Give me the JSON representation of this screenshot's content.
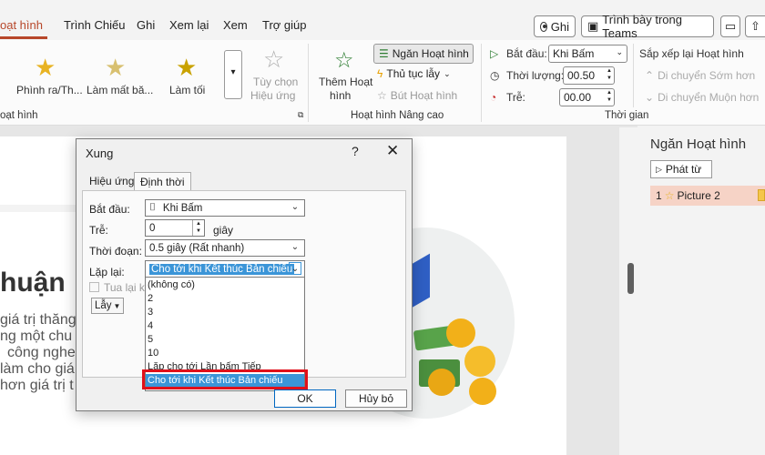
{
  "menu": {
    "tabs": [
      "oạt hình",
      "Trình Chiếu",
      "Ghi",
      "Xem lại",
      "Xem",
      "Trợ giúp"
    ],
    "record_button": "Ghi",
    "teams_button": "Trình bày trong Teams"
  },
  "ribbon": {
    "effects": [
      "Phình ra/Th...",
      "Làm mất bă...",
      "Làm tối"
    ],
    "effect_options": [
      "Tùy chọn",
      "Hiệu ứng"
    ],
    "group_animation": "oạt hình",
    "add_animation": [
      "Thêm Hoạt",
      "hình"
    ],
    "animation_pane": "Ngăn Hoạt hình",
    "trigger": "Thủ tục lẫy",
    "painter": "Bút Hoạt hình",
    "group_advanced": "Hoạt hình Nâng cao",
    "start_label": "Bắt đầu:",
    "start_value": "Khi Bấm",
    "duration_label": "Thời lượng:",
    "duration_value": "00.50",
    "delay_label": "Trễ:",
    "delay_value": "00.00",
    "reorder_title": "Sắp xếp lại Hoạt hình",
    "move_earlier": "Di chuyển Sớm hơn",
    "move_later": "Di chuyển Muộn hơn",
    "group_timing": "Thời gian"
  },
  "slide": {
    "heading": "huận",
    "lines": [
      "giá trị thăng",
      "ng một chu",
      "công nghe",
      "làm cho giá",
      "hơn giá trị t"
    ]
  },
  "pane": {
    "title": "Ngăn Hoạt hình",
    "play_from": "Phát từ",
    "item_index": "1",
    "item_label": "Picture 2"
  },
  "dialog": {
    "title": "Xung",
    "help": "?",
    "close": "✕",
    "tabs": [
      "Hiệu ứng",
      "Định thời"
    ],
    "start_label": "Bắt đầu:",
    "start_value": "Khi Bấm",
    "delay_label": "Trễ:",
    "delay_value": "0",
    "delay_unit": "giây",
    "duration_label": "Thời đoạn:",
    "duration_value": "0.5 giây (Rất nhanh)",
    "repeat_label": "Lặp lại:",
    "repeat_value": "Cho tới khi Kết thúc Bản chiếu",
    "rewind_label": "Tua lại kh",
    "triggers_label": "Lẫy",
    "options": [
      "(không có)",
      "2",
      "3",
      "4",
      "5",
      "10",
      "Lặp cho tới Lần bấm Tiếp",
      "Cho tới khi Kết thúc Bản chiếu"
    ],
    "ok": "OK",
    "cancel": "Hủy bỏ"
  },
  "colors": {
    "accent": "#b7472a",
    "selection": "#3b95d8",
    "callout": "#e0101a",
    "star": "#e8b323"
  }
}
